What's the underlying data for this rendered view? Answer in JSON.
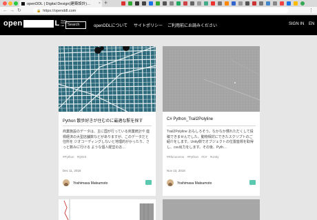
{
  "browser": {
    "tab_title": "openDDL | Digital Design(建築設計)…",
    "tab_close": "×",
    "new_tab": "+",
    "url": "https://openddl.com",
    "lock": "🔒",
    "nav_back": "←",
    "nav_forward": "→",
    "nav_reload": "↻",
    "menu": "⋮"
  },
  "site": {
    "logo_word": "open",
    "logo_end": "L",
    "logo_sub": "Digital Design Lab",
    "search_placeholder": "Search",
    "nav": [
      "openDDLについて",
      "サイトポリシー",
      "ご利用前にお読みください"
    ],
    "sign_in": "SIGN IN",
    "lang": "EN"
  },
  "cards": [
    {
      "title": "Python 散歩好きが住むのに最適な駅を探す",
      "description": "商業施設のデータは、主に国が行っている商業統計や 座標経済の大型店舗数などがありますが、このデータだと住所を ジオコーディングしないと地理的がかったり、さっと数みに行ける ような個人経営のお…",
      "tags": "#Python #QGIS",
      "date": "Dec 11, 2018",
      "author": "Yoshimasa Matsumoto"
    },
    {
      "title": "C# Python_Trail2Polyline",
      "description": "Trail2Polyline おもしろそう。なかなか慣れただくして投稿できませんでした。動物相対にできたスクリプトのご紹介をします。Unity側でオブジェクトの位置座標を取得し、csv出力をします。その後、Pyth…",
      "tags": "#Rhinoceros #Python #C# #Unity",
      "date": "Nov 13, 2018",
      "author": "Yoshimasa Matsumoto"
    }
  ],
  "colors": {
    "accent": "#5bc8b0",
    "map_bg": "#2d6b7d",
    "nav_bg": "#000000"
  }
}
